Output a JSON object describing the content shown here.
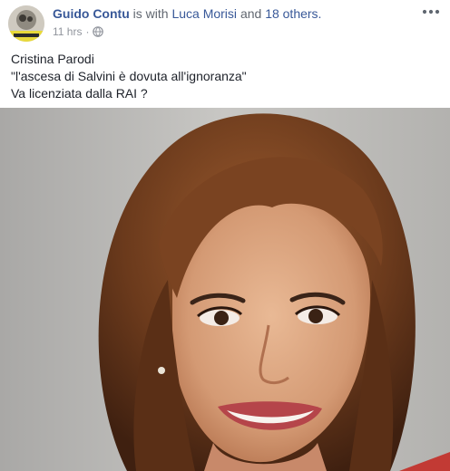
{
  "post": {
    "author": "Guido Contu",
    "with_text": "is with",
    "tagged_name": "Luca Morisi",
    "and_text": "and",
    "others_text": "18 others.",
    "time": "11 hrs",
    "separator": "·",
    "privacy_icon": "globe-icon",
    "more_icon": "more-dots-icon",
    "text_lines": [
      "Cristina Parodi",
      "\"l'ascesa di Salvini è dovuta all'ignoranza\"",
      "Va licenziata dalla RAI ?"
    ]
  },
  "colors": {
    "link": "#385898",
    "text": "#1d2129",
    "meta": "#90949c"
  }
}
